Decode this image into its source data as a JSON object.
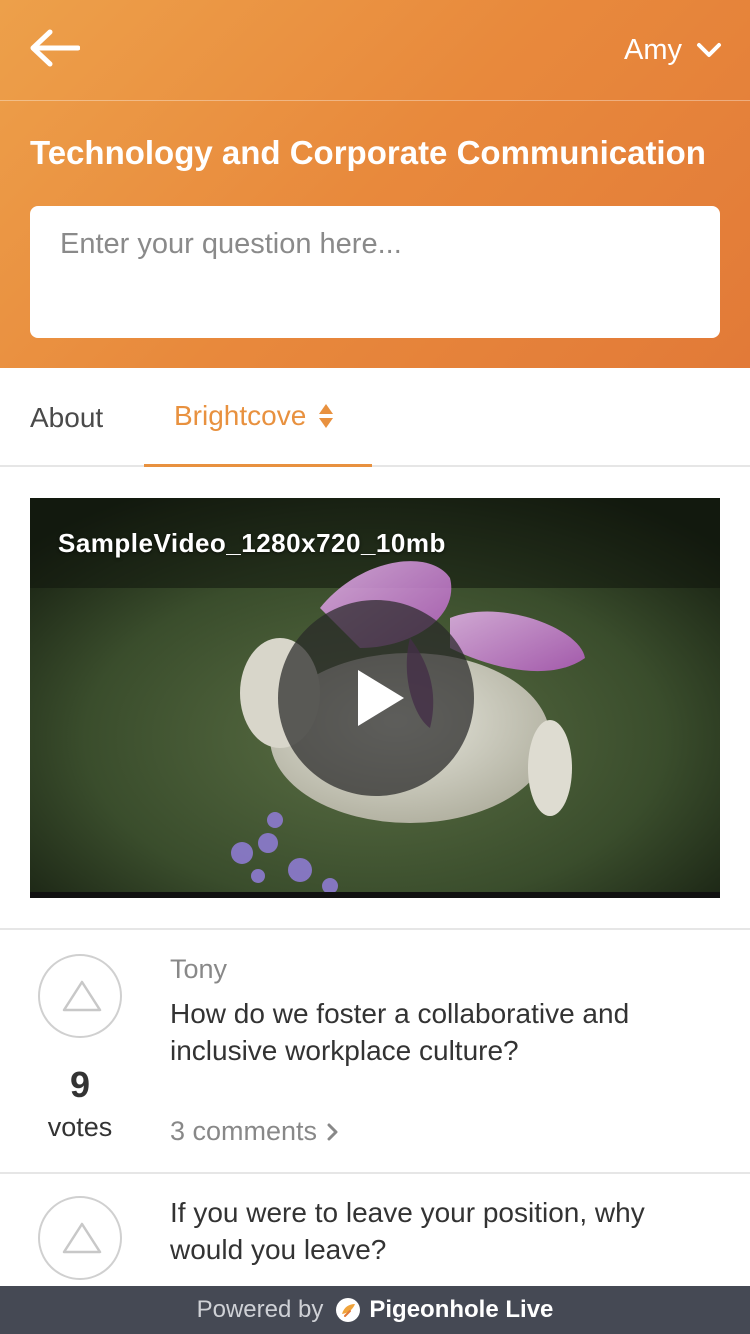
{
  "header": {
    "user_name": "Amy",
    "session_title": "Technology and Corporate Communication",
    "question_placeholder": "Enter your question here..."
  },
  "tabs": [
    {
      "label": "About",
      "active": false
    },
    {
      "label": "Brightcove",
      "active": true
    }
  ],
  "video": {
    "title": "SampleVideo_1280x720_10mb"
  },
  "questions": [
    {
      "author": "Tony",
      "text": "How do we foster a collaborative and inclusive workplace culture?",
      "votes": "9",
      "votes_label": "votes",
      "comments": "3 comments"
    },
    {
      "text": "If you were to leave your position, why would you leave?"
    }
  ],
  "footer": {
    "powered_by": "Powered by",
    "brand": "Pigeonhole Live"
  },
  "colors": {
    "accent": "#e8913f",
    "header_gradient_start": "#eda04a",
    "header_gradient_end": "#e27a38",
    "footer_bg": "#454954"
  },
  "icons": {
    "back": "arrow-left-icon",
    "user_menu": "chevron-down-icon",
    "sort": "sort-icon",
    "play": "play-icon",
    "vote": "triangle-up-icon",
    "comments": "chevron-right-icon",
    "logo": "pigeonhole-logo-icon"
  }
}
